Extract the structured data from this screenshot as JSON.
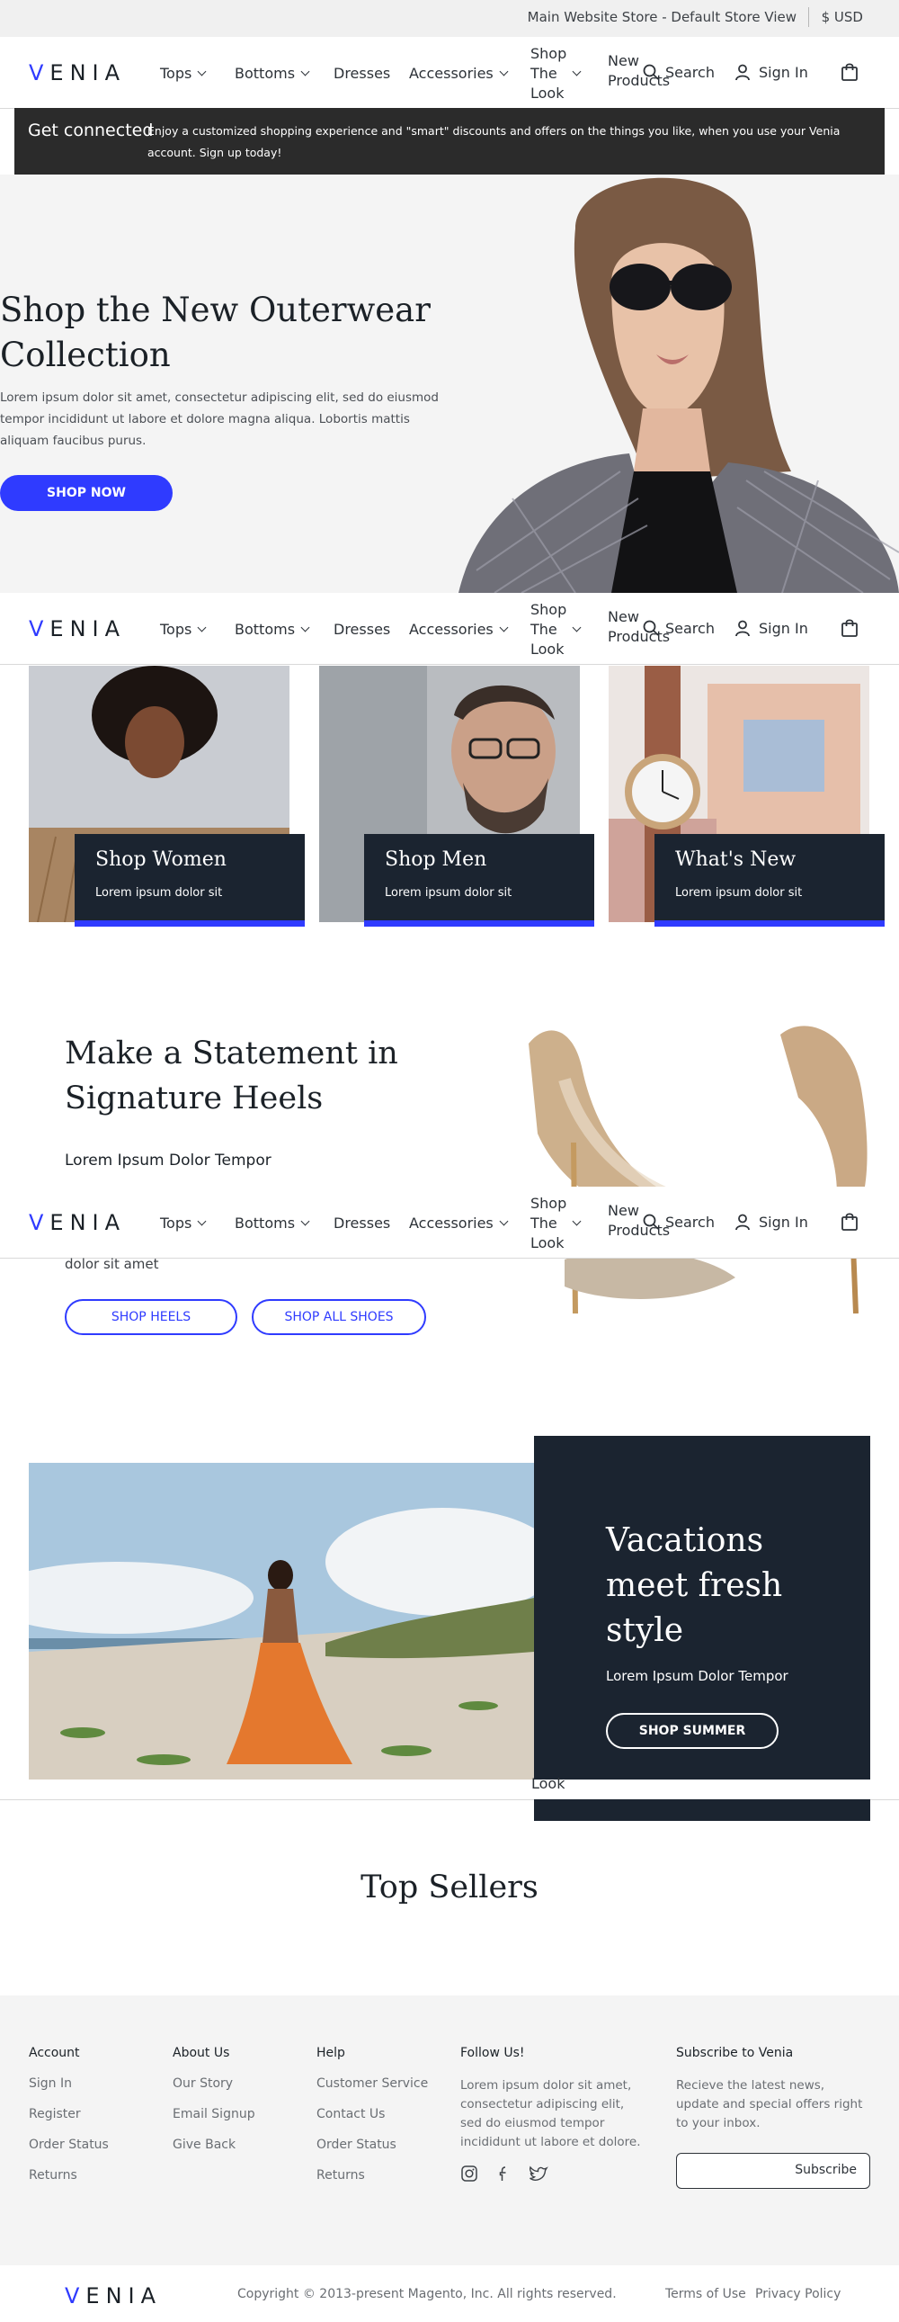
{
  "topbar": {
    "store": "Main Website Store - Default Store View",
    "currency": "$ USD"
  },
  "header": {
    "logo": "VENIA",
    "nav": [
      "Tops",
      "Bottoms",
      "Dresses",
      "Accessories"
    ],
    "shop_look": [
      "Shop",
      "The",
      "Look"
    ],
    "new_products": [
      "New",
      "Products"
    ],
    "search": "Search",
    "signin": "Sign In"
  },
  "connect": {
    "title": "Get connected",
    "text": "Enjoy a customized shopping experience and \"smart\" discounts and offers on the things you like, when you use your Venia account. Sign up today!"
  },
  "hero": {
    "title": "Shop the New Outerwear Collection",
    "text": "Lorem ipsum dolor sit amet, consectetur adipiscing elit, sed do eiusmod tempor incididunt ut labore et dolore magna aliqua. Lobortis mattis aliquam faucibus purus.",
    "button": "SHOP NOW"
  },
  "tiles": [
    {
      "title": "Shop Women",
      "subtitle": "Lorem ipsum dolor sit"
    },
    {
      "title": "Shop Men",
      "subtitle": "Lorem ipsum dolor sit"
    },
    {
      "title": "What's New",
      "subtitle": "Lorem ipsum dolor sit"
    }
  ],
  "heels": {
    "title": "Make a Statement in Signature Heels",
    "subtitle": "Lorem Ipsum Dolor Tempor",
    "text": "dolor sit amet",
    "button_heels": "SHOP HEELS",
    "button_shoes": "SHOP ALL SHOES"
  },
  "vacation": {
    "title": "Vacations meet fresh style",
    "subtitle": "Lorem Ipsum Dolor Tempor",
    "button": "SHOP SUMMER",
    "look_fragment": "Look"
  },
  "top_sellers": "Top Sellers",
  "footer": {
    "account": {
      "title": "Account",
      "items": [
        "Sign In",
        "Register",
        "Order Status",
        "Returns"
      ]
    },
    "about": {
      "title": "About Us",
      "items": [
        "Our Story",
        "Email Signup",
        "Give Back"
      ]
    },
    "help": {
      "title": "Help",
      "items": [
        "Customer Service",
        "Contact Us",
        "Order Status",
        "Returns"
      ]
    },
    "follow": {
      "title": "Follow Us!",
      "text": "Lorem ipsum dolor sit amet, consectetur adipiscing elit, sed do eiusmod tempor incididunt ut labore et dolore."
    },
    "subscribe": {
      "title": "Subscribe to Venia",
      "text": "Recieve the latest news, update and special offers right to your inbox.",
      "button": "Subscribe"
    },
    "logo": "VENIA",
    "copyright": "Copyright © 2013-present Magento, Inc. All rights reserved.",
    "terms": "Terms of Use",
    "privacy": "Privacy Policy"
  },
  "colors": {
    "accent": "#2f3bff",
    "dark": "#1b2430",
    "banner": "#2b2b2b"
  }
}
